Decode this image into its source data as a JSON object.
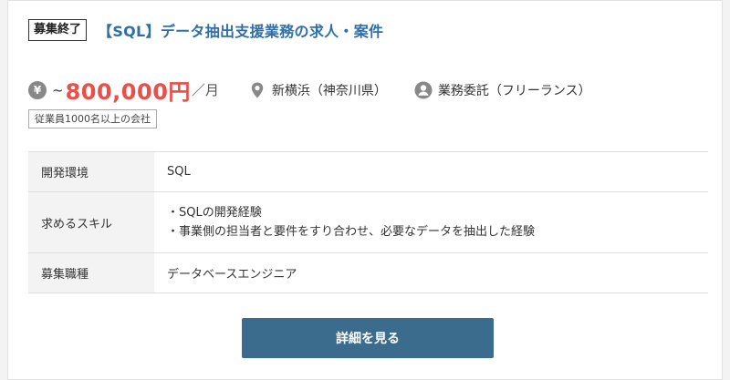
{
  "job": {
    "status_badge": "募集終了",
    "title": "【SQL】データ抽出支援業務の求人・案件",
    "salary": {
      "icon": "yen-icon",
      "icon_glyph": "¥",
      "prefix": "~",
      "value": "800,000円",
      "unit": "／月"
    },
    "location": {
      "icon": "location-pin-icon",
      "text": "新横浜（神奈川県）"
    },
    "contract": {
      "icon": "person-icon",
      "text": "業務委託（フリーランス）"
    },
    "company_tag": "従業員1000名以上の会社",
    "details": {
      "env_label": "開発環境",
      "env_value": "SQL",
      "skill_label": "求めるスキル",
      "skills": [
        "・SQLの開発経験",
        "・事業側の担当者と要件をすり合わせ、必要なデータを抽出した経験"
      ],
      "role_label": "募集職種",
      "role_value": "データベースエンジニア"
    },
    "button_label": "詳細を見る"
  },
  "colors": {
    "title": "#2f6fa8",
    "salary": "#e8504a",
    "button": "#3b6c8e",
    "label_bg": "#f3f3f3"
  }
}
